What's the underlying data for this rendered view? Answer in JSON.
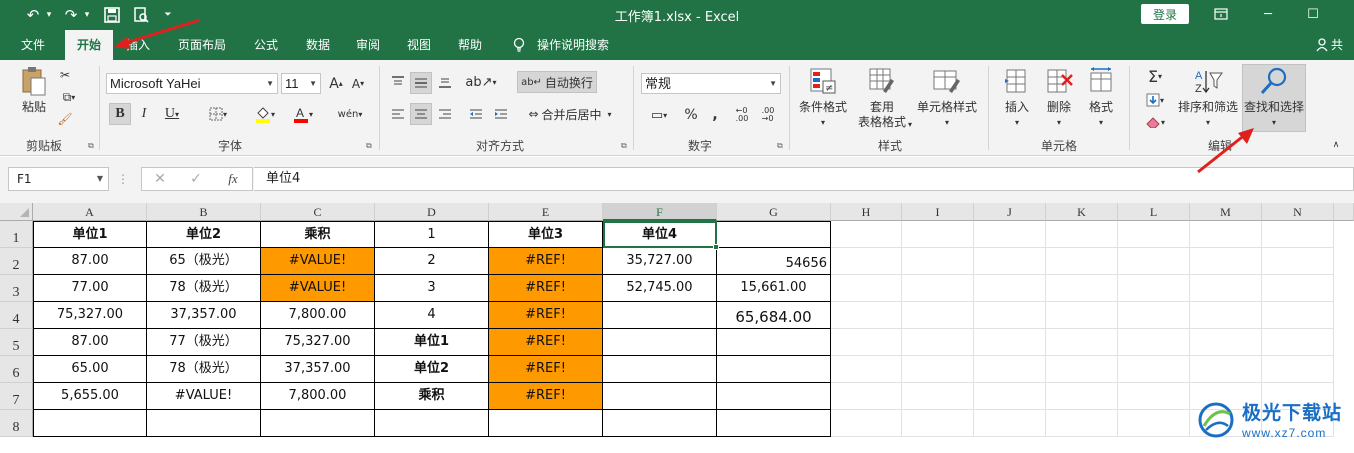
{
  "window": {
    "title": "工作簿1.xlsx  -  Excel",
    "login_label": "登录"
  },
  "tabs": [
    "文件",
    "开始",
    "插入",
    "页面布局",
    "公式",
    "数据",
    "审阅",
    "视图",
    "帮助"
  ],
  "tell_me": "操作说明搜索",
  "share_label": "共享",
  "ribbon": {
    "clipboard": {
      "paste_label": "粘贴",
      "group_label": "剪贴板"
    },
    "font": {
      "font_name": "Microsoft YaHei",
      "font_size": "11",
      "group_label": "字体"
    },
    "alignment": {
      "wrap_label": "自动换行",
      "merge_label": "合并后居中",
      "group_label": "对齐方式"
    },
    "number": {
      "format": "常规",
      "group_label": "数字"
    },
    "styles": {
      "conditional_label": "条件格式",
      "table_label_1": "套用",
      "table_label_2": "表格格式",
      "cell_styles_label": "单元格样式",
      "group_label": "样式"
    },
    "cells": {
      "insert_label": "插入",
      "delete_label": "删除",
      "format_label": "格式",
      "group_label": "单元格"
    },
    "editing": {
      "sort_label": "排序和筛选",
      "find_label": "查找和选择",
      "group_label": "编辑"
    }
  },
  "formula_bar": {
    "name_box": "F1",
    "formula": "单位4"
  },
  "sheet": {
    "columns": [
      "A",
      "B",
      "C",
      "D",
      "E",
      "F",
      "G",
      "H",
      "I",
      "J",
      "K",
      "L",
      "M",
      "N"
    ],
    "rows": [
      "1",
      "2",
      "3",
      "4",
      "5",
      "6",
      "7",
      "8"
    ],
    "cells": [
      [
        "单位1",
        "单位2",
        "乘积",
        "1",
        "单位3",
        "单位4",
        ""
      ],
      [
        "87.00",
        "65（极光）",
        "#VALUE!",
        "2",
        "#REF!",
        "35,727.00",
        "54656"
      ],
      [
        "77.00",
        "78（极光）",
        "#VALUE!",
        "3",
        "#REF!",
        "52,745.00",
        "15,661.00"
      ],
      [
        "75,327.00",
        "37,357.00",
        "7,800.00",
        "4",
        "#REF!",
        "",
        "65,684.00"
      ],
      [
        "87.00",
        "77（极光）",
        "75,327.00",
        "单位1",
        "#REF!",
        "",
        ""
      ],
      [
        "65.00",
        "78（极光）",
        "37,357.00",
        "单位2",
        "#REF!",
        "",
        ""
      ],
      [
        "5,655.00",
        "#VALUE!",
        "7,800.00",
        "乘积",
        "#REF!",
        "",
        ""
      ],
      [
        "",
        "",
        "",
        "",
        "",
        "",
        ""
      ]
    ],
    "selected_cell": "F1",
    "highlight_color": "#ff9900"
  },
  "watermark": {
    "title": "极光下载站",
    "url": "www.xz7.com"
  },
  "colors": {
    "excel_green": "#217346",
    "arrow_red": "#e0201c"
  }
}
